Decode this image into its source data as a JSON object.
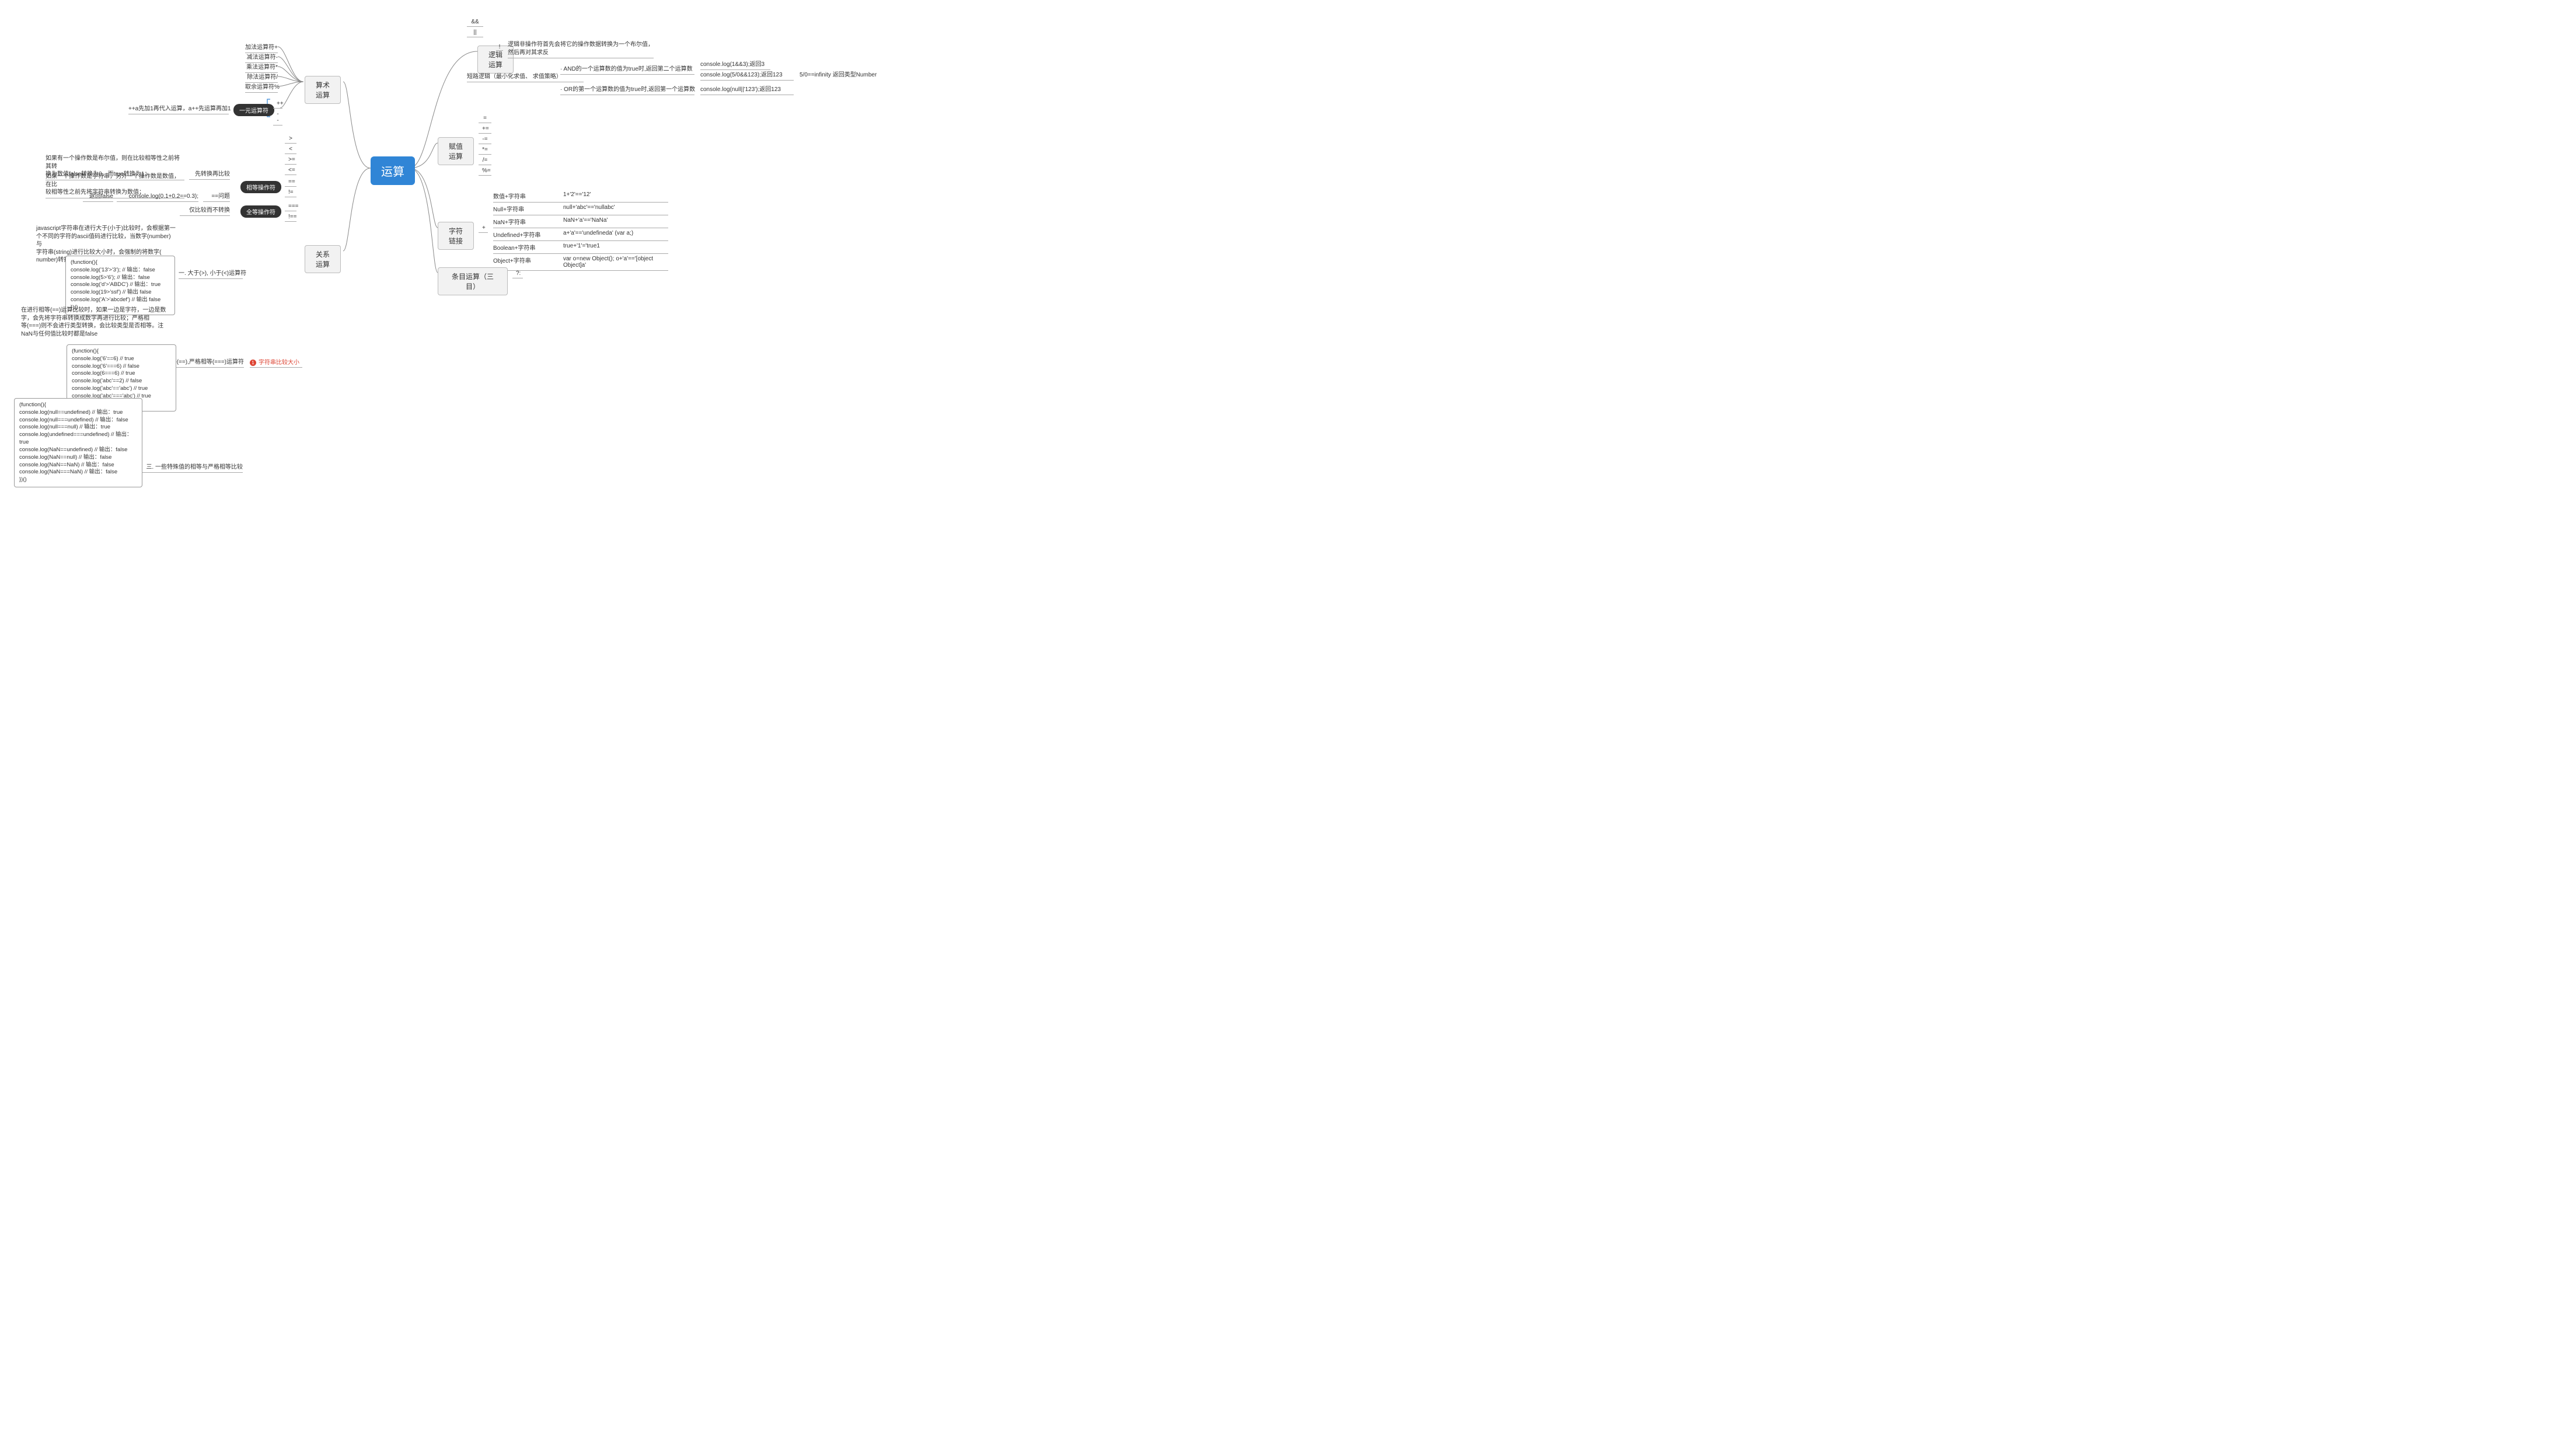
{
  "root": "运算",
  "left": {
    "arith": {
      "title": "算术运算",
      "ops": [
        "加法运算符+",
        "减法运算符-",
        "乘法运算符*",
        "除法运算符/",
        "取余运算符%"
      ],
      "unary": {
        "title": "一元运算符",
        "ops": [
          "++",
          "--"
        ],
        "note": "++a先加1再代入运算，a++先运算再加1"
      }
    },
    "rel": {
      "title": "关系运算",
      "cmp_ops": [
        ">",
        "<",
        ">=",
        "<="
      ],
      "eq": {
        "title": "相等操作符",
        "ops": [
          "==",
          "!="
        ],
        "convert_label": "先转换再比较",
        "rules": {
          "r1": "如果有一个操作数是布尔值，则在比较相等性之前将其转\n换为数值false转换为0，而true转换为1；",
          "r2": "如果一个操作数是字符串，另外一个操作数是数值，在比\n较相等性之前先将字符串转换为数值；",
          "eq_issue": "==问题",
          "eq_issue_example": "console.log(0.1+0.2==0.3);",
          "eq_issue_return": "返回false"
        }
      },
      "strict": {
        "title": "全等操作符",
        "ops": [
          "===",
          "!=="
        ],
        "note": "仅比较而不转换"
      },
      "compare_str": {
        "priority": "字符串比较大小",
        "section1": {
          "title": "一. 大于(>), 小于(<)运算符",
          "desc": "javascript字符串在进行大于(小于)比较时，会根据第一\n个不同的字符的ascii值码进行比较，当数字(number)与\n字符串(string)进行比较大小时，会强制的将数字(\nnumber)转换成字符串(string)然后再进行比较",
          "code": "(function(){\n    console.log('13'>'3'); // 输出：false\n    console.log(5>'6');  // 输出：false\n    console.log('d'>'ABDC') // 输出：true\n    console.log(19>'ssf') // 输出 false\n    console.log('A'>'abcdef') // 输出 false\n})()"
        },
        "section2": {
          "title": "二. 相等(==),严格相等(===)运算符",
          "desc": "在进行相等(==)运算比较时，如果一边是字符，一边是数\n字，会先将字符串转换成数字再进行比较；严格相\n等(===)则不会进行类型转换，会比较类型是否相等。注\nNaN与任何值比较时都是false",
          "code": "(function(){\n    console.log('6'==6) // true\n    console.log('6'===6) // false\n    console.log(6===6) // true\n    console.log('abc'==2) // false\n    console.log('abc'=='abc') // true\n    console.log('abc'==='abc') // true\n})()"
        },
        "section3": {
          "title": "三. 一些特殊值的相等与严格相等比较",
          "code": "(function(){\n  console.log(null==undefined) // 输出：true\n  console.log(null===undefined) // 输出：false\n  console.log(null===null) // 输出：true\n  console.log(undefined===undefined) // 输出：true\n  console.log(NaN==undefined) // 输出：false\n  console.log(NaN==null)  // 输出：false\n  console.log(NaN==NaN)  // 输出：false\n  console.log(NaN===NaN)  // 输出：false\n})()"
        }
      }
    }
  },
  "right": {
    "logic": {
      "title": "逻辑运算",
      "ops": {
        "and": "&&",
        "or": "||",
        "not": "!",
        "not_desc": "逻辑非操作符首先会将它的操作数据转换为一个布尔值，\n然后再对其求反"
      },
      "short": {
        "title": "短路逻辑（最小化求值、 求值策略）",
        "and_rule": "· AND的一个运算数的值为true时,返回第二个运算数",
        "and_ex1": "console.log(1&&3);返回3",
        "and_ex2": "console.log(5/0&&123);返回123",
        "and_ex2_note": "5/0==infinity 返回类型Number",
        "or_rule": "· OR的第一个运算数的值为true时,返回第一个运算数",
        "or_ex": "console.log(null||'123');返回123"
      }
    },
    "assign": {
      "title": "赋值运算",
      "ops": [
        "=",
        "+=",
        "-=",
        "*=",
        "/=",
        "%="
      ]
    },
    "concat": {
      "title": "字符链接",
      "op": "+",
      "rows": [
        {
          "k": "数值+字符串",
          "v": "1+'2'=='12'"
        },
        {
          "k": "Null+字符串",
          "v": "null+'abc'=='nullabc'"
        },
        {
          "k": "NaN+字符串",
          "v": "NaN+'a'=='NaNa'"
        },
        {
          "k": "Undefined+字符串",
          "v": "a+'a'=='undefineda'   (var a;)"
        },
        {
          "k": "Boolean+字符串",
          "v": "true+'1'='true1"
        },
        {
          "k": "Object+字符串",
          "v": "var o=new Object();   o+'a'=='[object Object]a'"
        }
      ]
    },
    "ternary": {
      "title": "条目运算（三目）",
      "op": "?:"
    }
  }
}
